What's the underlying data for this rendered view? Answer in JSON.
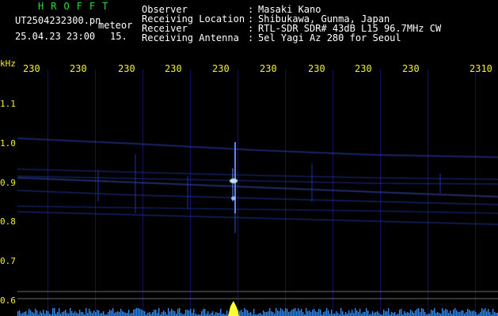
{
  "header": {
    "logo": "HROFFT",
    "filename": "UT2504232300.pn",
    "filename_suffix": "meteor",
    "datetime": "25.04.23 23:00",
    "count": "15.",
    "info": [
      {
        "label": "Observer",
        "sep": ":",
        "value": "Masaki Kano"
      },
      {
        "label": "Receiving Location",
        "sep": ":",
        "value": "Shibukawa, Gunma, Japan"
      },
      {
        "label": "Receiver",
        "sep": ":",
        "value": "RTL-SDR SDR# 43dB L15 96.7MHz CW"
      },
      {
        "label": "Receiving Antenna",
        "sep": ":",
        "value": "5el Yagi Az 280 for Seoul"
      }
    ]
  },
  "axes": {
    "y_unit": "kHz",
    "y_ticks": [
      "1.1",
      "1.0",
      "0.9",
      "0.8",
      "0.7",
      "0.6"
    ],
    "time_ticks": [
      "230",
      "230",
      "230",
      "230",
      "230",
      "230",
      "230",
      "230",
      "230",
      "2310"
    ]
  },
  "colors": {
    "background": "#000000",
    "text": "#ffffff",
    "logo": "#22e03a",
    "axis": "#f3ef2e",
    "trace": "#3a5cff",
    "meteor_head": "#bfe8ff",
    "power": "#2f8cff",
    "power_peak": "#ffff33"
  }
}
